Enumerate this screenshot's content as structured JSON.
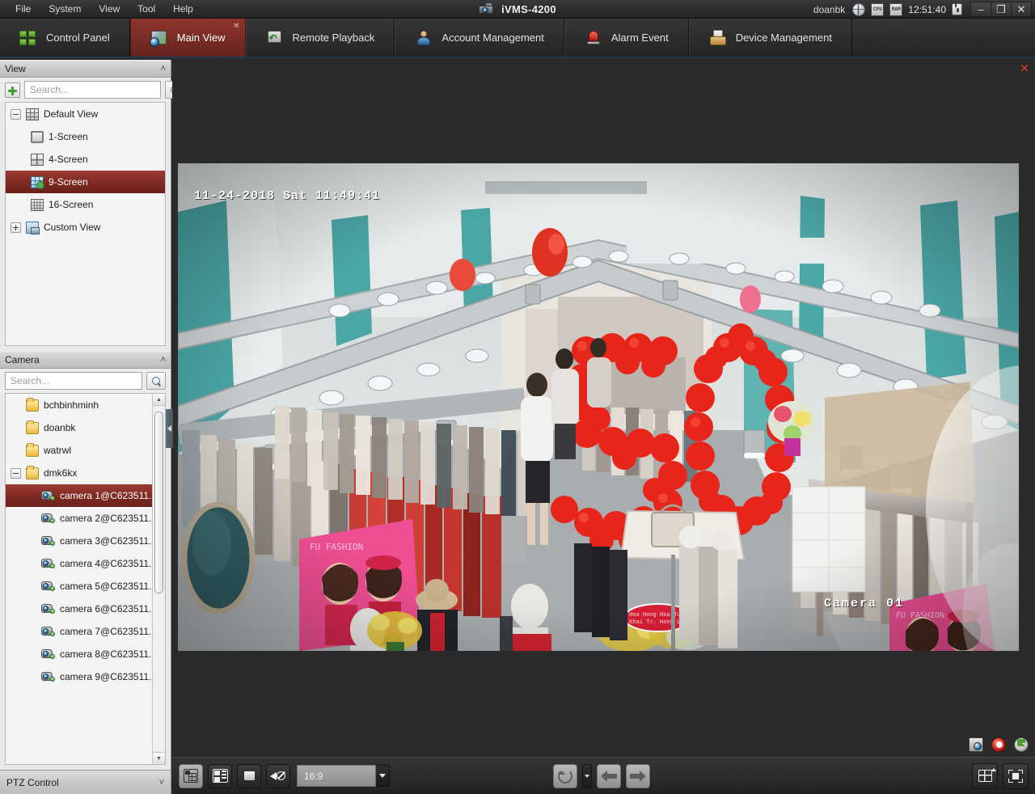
{
  "titlebar": {
    "menus": [
      "File",
      "System",
      "View",
      "Tool",
      "Help"
    ],
    "app_title": "iVMS-4200",
    "user": "doanbk",
    "clock": "12:51:40",
    "cpu_label": "CPU",
    "ram_label": "RAM",
    "minimize": "–",
    "restore": "❐",
    "close": "✕"
  },
  "tabs": [
    {
      "label": "Control Panel",
      "icon": "grid4-icon",
      "active": false
    },
    {
      "label": "Main View",
      "icon": "mainview-icon",
      "active": true,
      "close": "✕"
    },
    {
      "label": "Remote Playback",
      "icon": "playback-icon",
      "active": false
    },
    {
      "label": "Account Management",
      "icon": "user-icon",
      "active": false
    },
    {
      "label": "Alarm Event",
      "icon": "alarm-icon",
      "active": false
    },
    {
      "label": "Device Management",
      "icon": "device-icon",
      "active": false
    }
  ],
  "view_panel": {
    "title": "View",
    "collapse_chevron": "˄",
    "search_placeholder": "Search...",
    "add_title": "Add View",
    "items": [
      {
        "label": "Default View",
        "icon": "view-grid-icon",
        "indent": 0,
        "expander": "minus",
        "selected": false
      },
      {
        "label": "1-Screen",
        "icon": "screen-1-icon",
        "indent": 1,
        "expander": "none",
        "selected": false
      },
      {
        "label": "4-Screen",
        "icon": "screen-4-icon",
        "indent": 1,
        "expander": "none",
        "selected": false
      },
      {
        "label": "9-Screen",
        "icon": "screen-9-icon",
        "indent": 1,
        "expander": "none",
        "selected": true
      },
      {
        "label": "16-Screen",
        "icon": "screen-16-icon",
        "indent": 1,
        "expander": "none",
        "selected": false
      },
      {
        "label": "Custom View",
        "icon": "custom-view-icon",
        "indent": 0,
        "expander": "plus",
        "selected": false
      }
    ]
  },
  "camera_panel": {
    "title": "Camera",
    "collapse_chevron": "˄",
    "search_placeholder": "Search...",
    "items": [
      {
        "label": "bchbinhminh",
        "icon": "folder-icon",
        "indent": 0,
        "expander": "none",
        "selected": false
      },
      {
        "label": "doanbk",
        "icon": "folder-icon",
        "indent": 0,
        "expander": "none",
        "selected": false
      },
      {
        "label": "watrwl",
        "icon": "folder-icon",
        "indent": 0,
        "expander": "none",
        "selected": false
      },
      {
        "label": "dmk6kx",
        "icon": "folder-icon",
        "indent": 0,
        "expander": "minus",
        "selected": false
      },
      {
        "label": "camera 1@C623511...",
        "icon": "camera-icon",
        "indent": 1,
        "expander": "none",
        "selected": true
      },
      {
        "label": "camera 2@C623511...",
        "icon": "camera-icon",
        "indent": 1,
        "expander": "none",
        "selected": false
      },
      {
        "label": "camera 3@C623511...",
        "icon": "camera-icon",
        "indent": 1,
        "expander": "none",
        "selected": false
      },
      {
        "label": "camera 4@C623511...",
        "icon": "camera-icon",
        "indent": 1,
        "expander": "none",
        "selected": false
      },
      {
        "label": "camera 5@C623511...",
        "icon": "camera-icon",
        "indent": 1,
        "expander": "none",
        "selected": false
      },
      {
        "label": "camera 6@C623511...",
        "icon": "camera-icon",
        "indent": 1,
        "expander": "none",
        "selected": false
      },
      {
        "label": "camera 7@C623511...",
        "icon": "camera-icon",
        "indent": 1,
        "expander": "none",
        "selected": false
      },
      {
        "label": "camera 8@C623511...",
        "icon": "camera-icon",
        "indent": 1,
        "expander": "none",
        "selected": false
      },
      {
        "label": "camera 9@C623511...",
        "icon": "camera-icon",
        "indent": 1,
        "expander": "none",
        "selected": false
      }
    ],
    "scroll_up": "▲",
    "scroll_down": "▼"
  },
  "ptz_panel": {
    "title": "PTZ Control",
    "expand_chevron": "˅"
  },
  "main_view": {
    "close_label": "✕",
    "video": {
      "timestamp": "11-24-2018 Sat 11:49:41",
      "camera_label": "Camera 01",
      "scene": "clothing store interior with red balloon 50 display"
    },
    "overlay_tools": [
      {
        "name": "capture-icon"
      },
      {
        "name": "record-icon"
      },
      {
        "name": "instant-playback-icon"
      }
    ]
  },
  "bottom_toolbar": {
    "left_buttons": [
      {
        "name": "save-layout-button",
        "icon": "save-icon",
        "active": true
      },
      {
        "name": "window-division-button",
        "icon": "layout-icon",
        "active": false
      },
      {
        "name": "stop-all-button",
        "icon": "stop-icon",
        "active": false
      },
      {
        "name": "mute-all-button",
        "icon": "mute-icon",
        "active": false
      }
    ],
    "aspect_ratio": {
      "value": "16:9",
      "caret": "▾"
    },
    "center_buttons": [
      {
        "name": "auto-switch-button",
        "icon": "refresh-icon"
      },
      {
        "name": "auto-switch-dropdown",
        "icon": "caret-down-icon"
      },
      {
        "name": "previous-page-button",
        "icon": "arrow-left-icon"
      },
      {
        "name": "next-page-button",
        "icon": "arrow-right-icon"
      }
    ],
    "right_buttons": [
      {
        "name": "window-split-button",
        "icon": "window-split-icon"
      },
      {
        "name": "full-screen-button",
        "icon": "fullscreen-icon"
      }
    ]
  },
  "colors": {
    "accent_red": "#7c2a23",
    "selection_red": "#8a2f28",
    "titlebar_dark": "#2d2d2d",
    "sidebar_bg": "#e9e9e9",
    "blue_underline": "#1b3a52"
  }
}
